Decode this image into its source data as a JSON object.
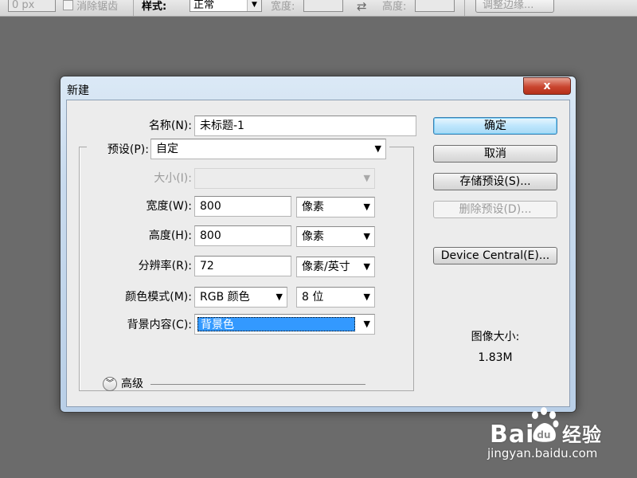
{
  "options_bar": {
    "feather_value": "0 px",
    "antialias_label": "消除锯齿",
    "style_label": "样式:",
    "style_value": "正常",
    "width_label": "宽度:",
    "swap_icon": "swap-arrows-icon",
    "height_label": "高度:",
    "refine_edge_label": "调整边缘..."
  },
  "dialog": {
    "title": "新建",
    "close_glyph": "x",
    "name_label": "名称(N):",
    "name_value": "未标题-1",
    "preset_label": "预设(P):",
    "preset_value": "自定",
    "size_label": "大小(I):",
    "size_value": "",
    "width_label": "宽度(W):",
    "width_value": "800",
    "width_unit": "像素",
    "height_label": "高度(H):",
    "height_value": "800",
    "height_unit": "像素",
    "resolution_label": "分辨率(R):",
    "resolution_value": "72",
    "resolution_unit": "像素/英寸",
    "color_mode_label": "颜色模式(M):",
    "color_mode_value": "RGB 颜色",
    "bit_depth_value": "8 位",
    "background_label": "背景内容(C):",
    "background_value": "背景色",
    "advanced_label": "高级",
    "buttons": {
      "ok": "确定",
      "cancel": "取消",
      "save_preset": "存储预设(S)...",
      "delete_preset": "删除预设(D)...",
      "device_central": "Device Central(E)..."
    },
    "image_size_label": "图像大小:",
    "image_size_value": "1.83M"
  },
  "watermark": {
    "brand": "Bai",
    "brand_cn": "经验",
    "url": "jingyan.baidu.com"
  },
  "colors": {
    "workspace": "#6b6b6b",
    "highlight": "#3399ff",
    "close_button": "#c9452f"
  }
}
